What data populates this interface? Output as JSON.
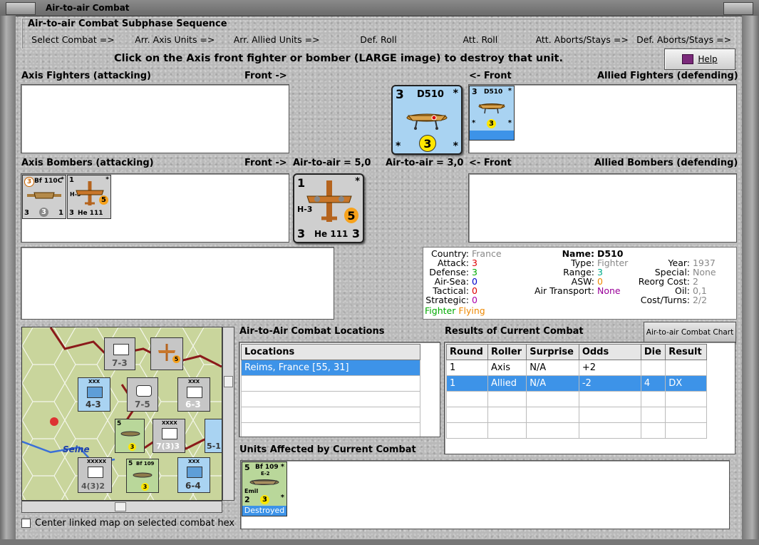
{
  "window": {
    "title": "Air-to-air Combat"
  },
  "sequence": {
    "title": "Air-to-air Combat Subphase Sequence",
    "steps": [
      "Select Combat =>",
      "Arr. Axis Units =>",
      "Arr. Allied Units =>",
      "Def. Roll",
      "Att. Roll",
      "Att. Aborts/Stays =>",
      "Def. Aborts/Stays =>"
    ]
  },
  "instruction": "Click on the Axis front fighter or bomber (LARGE image) to destroy that unit.",
  "help_label": "Help",
  "labels": {
    "axis_fighters": "Axis Fighters (attacking)",
    "front_right": "Front ->",
    "front_left": "<- Front",
    "allied_fighters": "Allied Fighters (defending)",
    "axis_bombers": "Axis Bombers (attacking)",
    "allied_bombers": "Allied Bombers (defending)",
    "axis_air": "Air-to-air = 5,0",
    "allied_air": "Air-to-air = 3,0"
  },
  "counters": {
    "d510_big": {
      "top_left": "3",
      "name": "D510",
      "star": "*",
      "attack": "3"
    },
    "d510_small": {
      "top_left": "3",
      "name": "D510",
      "star": "*",
      "attack": "3"
    },
    "bf110": {
      "top_left": "3",
      "name": "Bf 110C",
      "bottom_left": "3",
      "center": "3",
      "bottom_right": "1",
      "star": "*"
    },
    "he111_small": {
      "top_left": "1",
      "sub": "H-3",
      "attack": "5",
      "bottom_left": "3",
      "name": "He 111",
      "star": "*"
    },
    "he111_big": {
      "top_left": "1",
      "sub": "H-3",
      "attack": "5",
      "bottom_left": "3",
      "name": "He 111",
      "bottom_right": "3",
      "star": "*"
    },
    "bf109": {
      "top_left": "5",
      "name": "Bf 109",
      "sub": "E-2",
      "label2": "Emil",
      "bottom_left": "2",
      "attack": "3",
      "star": "*",
      "status": "Destroyed"
    }
  },
  "unit_info": {
    "country_k": "Country:",
    "country_v": "France",
    "attack_k": "Attack:",
    "attack_v": "3",
    "defense_k": "Defense:",
    "defense_v": "3",
    "airsea_k": "Air-Sea:",
    "airsea_v": "0",
    "tactical_k": "Tactical:",
    "tactical_v": "0",
    "strategic_k": "Strategic:",
    "strategic_v": "0",
    "fighter_word": "Fighter",
    "flying_word": "Flying",
    "name_k": "Name:",
    "name_v": "D510",
    "type_k": "Type:",
    "type_v": "Fighter",
    "range_k": "Range:",
    "range_v": "3",
    "asw_k": "ASW:",
    "asw_v": "0",
    "airtrans_k": "Air Transport:",
    "airtrans_v": "None",
    "year_k": "Year:",
    "year_v": "1937",
    "special_k": "Special:",
    "special_v": "None",
    "reorg_k": "Reorg Cost:",
    "reorg_v": "2",
    "oil_k": "Oil:",
    "oil_v": "0,1",
    "costturns_k": "Cost/Turns:",
    "costturns_v": "2/2"
  },
  "map": {
    "river": "Seine",
    "units": [
      {
        "top": "",
        "bottom": "7-3"
      },
      {
        "top": "XXX",
        "bottom": "4-3"
      },
      {
        "top": "",
        "bottom": "7-5"
      },
      {
        "top": "XXX",
        "bottom": "6-3"
      },
      {
        "top": "XXXX",
        "bottom": "7(3)3"
      },
      {
        "top": "XXXXX",
        "bottom": "4(3)2"
      },
      {
        "top": "XXX",
        "bottom": "6-4"
      },
      {
        "top": "",
        "bottom": "5-1"
      }
    ]
  },
  "locations": {
    "title": "Air-to-Air Combat Locations",
    "header": "Locations",
    "rows": [
      "Reims, France [55, 31]",
      "",
      "",
      "",
      "",
      ""
    ]
  },
  "results": {
    "title": "Results of Current Combat",
    "chart_button": "Air-to-air Combat Chart",
    "headers": [
      "Round",
      "Roller",
      "Surprise",
      "Odds",
      "Die",
      "Result"
    ],
    "rows": [
      [
        "1",
        "Axis",
        "N/A",
        "+2",
        "",
        ""
      ],
      [
        "1",
        "Allied",
        "N/A",
        "-2",
        "4",
        "DX"
      ],
      [
        "",
        "",
        "",
        "",
        "",
        ""
      ],
      [
        "",
        "",
        "",
        "",
        "",
        ""
      ],
      [
        "",
        "",
        "",
        "",
        "",
        ""
      ]
    ]
  },
  "affected": {
    "title": "Units Affected by Current Combat"
  },
  "center_checkbox": "Center linked map on selected combat hex",
  "colors": {
    "fighter_bg": "#a9d3f2",
    "axis_bg": "#cfcfcf",
    "selection": "#3d93e8",
    "yellow_circle": "#ffe600",
    "orange_circle": "#f7a21b"
  }
}
